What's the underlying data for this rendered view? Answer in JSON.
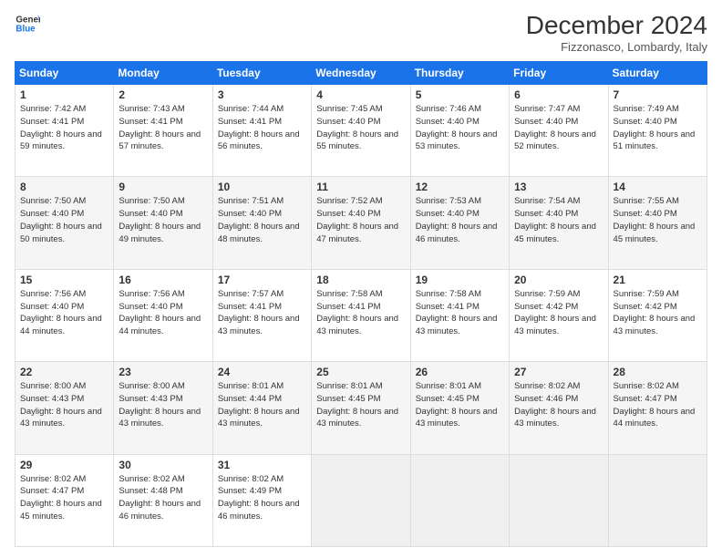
{
  "header": {
    "logo_line1": "General",
    "logo_line2": "Blue",
    "month": "December 2024",
    "location": "Fizzonasco, Lombardy, Italy"
  },
  "weekdays": [
    "Sunday",
    "Monday",
    "Tuesday",
    "Wednesday",
    "Thursday",
    "Friday",
    "Saturday"
  ],
  "weeks": [
    [
      {
        "day": "1",
        "sunrise": "Sunrise: 7:42 AM",
        "sunset": "Sunset: 4:41 PM",
        "daylight": "Daylight: 8 hours and 59 minutes."
      },
      {
        "day": "2",
        "sunrise": "Sunrise: 7:43 AM",
        "sunset": "Sunset: 4:41 PM",
        "daylight": "Daylight: 8 hours and 57 minutes."
      },
      {
        "day": "3",
        "sunrise": "Sunrise: 7:44 AM",
        "sunset": "Sunset: 4:41 PM",
        "daylight": "Daylight: 8 hours and 56 minutes."
      },
      {
        "day": "4",
        "sunrise": "Sunrise: 7:45 AM",
        "sunset": "Sunset: 4:40 PM",
        "daylight": "Daylight: 8 hours and 55 minutes."
      },
      {
        "day": "5",
        "sunrise": "Sunrise: 7:46 AM",
        "sunset": "Sunset: 4:40 PM",
        "daylight": "Daylight: 8 hours and 53 minutes."
      },
      {
        "day": "6",
        "sunrise": "Sunrise: 7:47 AM",
        "sunset": "Sunset: 4:40 PM",
        "daylight": "Daylight: 8 hours and 52 minutes."
      },
      {
        "day": "7",
        "sunrise": "Sunrise: 7:49 AM",
        "sunset": "Sunset: 4:40 PM",
        "daylight": "Daylight: 8 hours and 51 minutes."
      }
    ],
    [
      {
        "day": "8",
        "sunrise": "Sunrise: 7:50 AM",
        "sunset": "Sunset: 4:40 PM",
        "daylight": "Daylight: 8 hours and 50 minutes."
      },
      {
        "day": "9",
        "sunrise": "Sunrise: 7:50 AM",
        "sunset": "Sunset: 4:40 PM",
        "daylight": "Daylight: 8 hours and 49 minutes."
      },
      {
        "day": "10",
        "sunrise": "Sunrise: 7:51 AM",
        "sunset": "Sunset: 4:40 PM",
        "daylight": "Daylight: 8 hours and 48 minutes."
      },
      {
        "day": "11",
        "sunrise": "Sunrise: 7:52 AM",
        "sunset": "Sunset: 4:40 PM",
        "daylight": "Daylight: 8 hours and 47 minutes."
      },
      {
        "day": "12",
        "sunrise": "Sunrise: 7:53 AM",
        "sunset": "Sunset: 4:40 PM",
        "daylight": "Daylight: 8 hours and 46 minutes."
      },
      {
        "day": "13",
        "sunrise": "Sunrise: 7:54 AM",
        "sunset": "Sunset: 4:40 PM",
        "daylight": "Daylight: 8 hours and 45 minutes."
      },
      {
        "day": "14",
        "sunrise": "Sunrise: 7:55 AM",
        "sunset": "Sunset: 4:40 PM",
        "daylight": "Daylight: 8 hours and 45 minutes."
      }
    ],
    [
      {
        "day": "15",
        "sunrise": "Sunrise: 7:56 AM",
        "sunset": "Sunset: 4:40 PM",
        "daylight": "Daylight: 8 hours and 44 minutes."
      },
      {
        "day": "16",
        "sunrise": "Sunrise: 7:56 AM",
        "sunset": "Sunset: 4:40 PM",
        "daylight": "Daylight: 8 hours and 44 minutes."
      },
      {
        "day": "17",
        "sunrise": "Sunrise: 7:57 AM",
        "sunset": "Sunset: 4:41 PM",
        "daylight": "Daylight: 8 hours and 43 minutes."
      },
      {
        "day": "18",
        "sunrise": "Sunrise: 7:58 AM",
        "sunset": "Sunset: 4:41 PM",
        "daylight": "Daylight: 8 hours and 43 minutes."
      },
      {
        "day": "19",
        "sunrise": "Sunrise: 7:58 AM",
        "sunset": "Sunset: 4:41 PM",
        "daylight": "Daylight: 8 hours and 43 minutes."
      },
      {
        "day": "20",
        "sunrise": "Sunrise: 7:59 AM",
        "sunset": "Sunset: 4:42 PM",
        "daylight": "Daylight: 8 hours and 43 minutes."
      },
      {
        "day": "21",
        "sunrise": "Sunrise: 7:59 AM",
        "sunset": "Sunset: 4:42 PM",
        "daylight": "Daylight: 8 hours and 43 minutes."
      }
    ],
    [
      {
        "day": "22",
        "sunrise": "Sunrise: 8:00 AM",
        "sunset": "Sunset: 4:43 PM",
        "daylight": "Daylight: 8 hours and 43 minutes."
      },
      {
        "day": "23",
        "sunrise": "Sunrise: 8:00 AM",
        "sunset": "Sunset: 4:43 PM",
        "daylight": "Daylight: 8 hours and 43 minutes."
      },
      {
        "day": "24",
        "sunrise": "Sunrise: 8:01 AM",
        "sunset": "Sunset: 4:44 PM",
        "daylight": "Daylight: 8 hours and 43 minutes."
      },
      {
        "day": "25",
        "sunrise": "Sunrise: 8:01 AM",
        "sunset": "Sunset: 4:45 PM",
        "daylight": "Daylight: 8 hours and 43 minutes."
      },
      {
        "day": "26",
        "sunrise": "Sunrise: 8:01 AM",
        "sunset": "Sunset: 4:45 PM",
        "daylight": "Daylight: 8 hours and 43 minutes."
      },
      {
        "day": "27",
        "sunrise": "Sunrise: 8:02 AM",
        "sunset": "Sunset: 4:46 PM",
        "daylight": "Daylight: 8 hours and 43 minutes."
      },
      {
        "day": "28",
        "sunrise": "Sunrise: 8:02 AM",
        "sunset": "Sunset: 4:47 PM",
        "daylight": "Daylight: 8 hours and 44 minutes."
      }
    ],
    [
      {
        "day": "29",
        "sunrise": "Sunrise: 8:02 AM",
        "sunset": "Sunset: 4:47 PM",
        "daylight": "Daylight: 8 hours and 45 minutes."
      },
      {
        "day": "30",
        "sunrise": "Sunrise: 8:02 AM",
        "sunset": "Sunset: 4:48 PM",
        "daylight": "Daylight: 8 hours and 46 minutes."
      },
      {
        "day": "31",
        "sunrise": "Sunrise: 8:02 AM",
        "sunset": "Sunset: 4:49 PM",
        "daylight": "Daylight: 8 hours and 46 minutes."
      },
      null,
      null,
      null,
      null
    ]
  ]
}
